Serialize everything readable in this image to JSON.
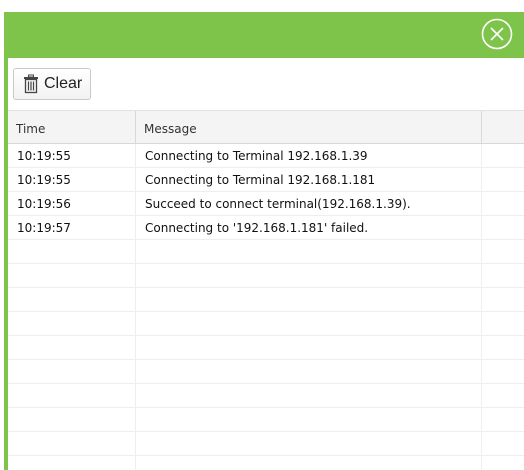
{
  "window": {
    "accent_color": "#7fc44a",
    "close_icon": "close-circle-icon"
  },
  "toolbar": {
    "clear_label": "Clear",
    "clear_icon": "trash-icon"
  },
  "grid": {
    "columns": [
      "Time",
      "Message",
      ""
    ],
    "rows": [
      {
        "time": "10:19:55",
        "message": "Connecting to Terminal 192.168.1.39"
      },
      {
        "time": "10:19:55",
        "message": "Connecting to Terminal 192.168.1.181"
      },
      {
        "time": "10:19:56",
        "message": "Succeed to connect terminal(192.168.1.39)."
      },
      {
        "time": "10:19:57",
        "message": "Connecting to '192.168.1.181' failed."
      },
      {
        "time": "",
        "message": ""
      },
      {
        "time": "",
        "message": ""
      },
      {
        "time": "",
        "message": ""
      },
      {
        "time": "",
        "message": ""
      },
      {
        "time": "",
        "message": ""
      },
      {
        "time": "",
        "message": ""
      },
      {
        "time": "",
        "message": ""
      },
      {
        "time": "",
        "message": ""
      },
      {
        "time": "",
        "message": ""
      },
      {
        "time": "",
        "message": ""
      }
    ]
  }
}
